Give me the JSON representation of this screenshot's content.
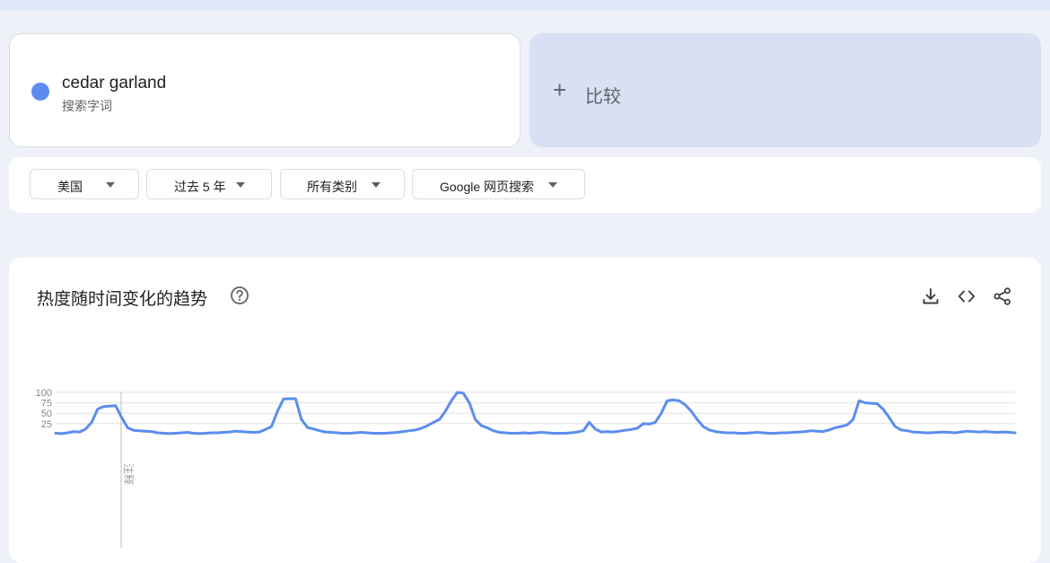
{
  "term": {
    "name": "cedar garland",
    "subtitle": "搜索字词",
    "color": "#5b8def"
  },
  "compare": {
    "icon": "plus-icon",
    "label": "比较"
  },
  "filters": [
    {
      "label": "美国"
    },
    {
      "label": "过去 5 年"
    },
    {
      "label": "所有类别"
    },
    {
      "label": "Google 网页搜索"
    }
  ],
  "chart_section": {
    "title": "热度随时间变化的趋势",
    "icons": [
      "help-icon",
      "download-icon",
      "embed-code-icon",
      "share-icon"
    ]
  },
  "chart_data": {
    "type": "line",
    "y_ticks": [
      "100",
      "75",
      "50",
      "25"
    ],
    "ylim": [
      0,
      100
    ],
    "grid": true,
    "annotation": "注释",
    "series": [
      {
        "color": "#5b8def",
        "values": [
          2,
          1,
          3,
          6,
          5,
          12,
          28,
          60,
          66,
          67,
          68,
          40,
          15,
          9,
          8,
          7,
          6,
          3,
          2,
          1,
          2,
          3,
          4,
          2,
          1,
          2,
          3,
          3,
          4,
          5,
          7,
          6,
          5,
          4,
          5,
          11,
          18,
          55,
          84,
          85,
          85,
          35,
          16,
          12,
          8,
          5,
          4,
          3,
          2,
          2,
          3,
          4,
          3,
          2,
          2,
          2,
          3,
          4,
          6,
          8,
          10,
          14,
          20,
          28,
          35,
          55,
          80,
          100,
          98,
          75,
          35,
          20,
          15,
          8,
          4,
          3,
          2,
          2,
          3,
          2,
          3,
          4,
          3,
          2,
          2,
          2,
          3,
          5,
          8,
          28,
          12,
          5,
          6,
          5,
          7,
          9,
          11,
          14,
          25,
          24,
          28,
          50,
          80,
          82,
          80,
          70,
          55,
          35,
          18,
          10,
          6,
          4,
          3,
          3,
          2,
          2,
          3,
          4,
          3,
          2,
          2,
          3,
          3,
          4,
          5,
          6,
          8,
          7,
          6,
          10,
          15,
          18,
          22,
          35,
          80,
          75,
          74,
          73,
          60,
          40,
          18,
          10,
          8,
          5,
          4,
          3,
          3,
          4,
          5,
          4,
          3,
          5,
          7,
          6,
          5,
          6,
          5,
          4,
          5,
          4,
          3
        ]
      }
    ]
  }
}
